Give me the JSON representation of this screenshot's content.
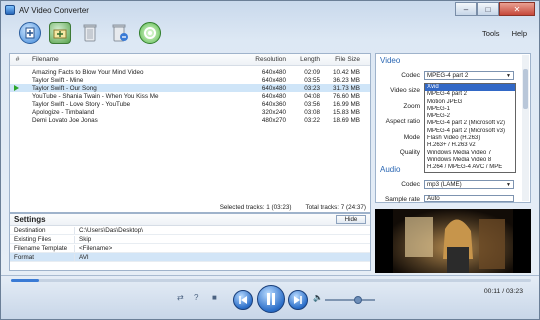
{
  "window": {
    "title": "AV Video Converter"
  },
  "toolbar": {
    "menu": [
      "Tools",
      "Help"
    ]
  },
  "table": {
    "columns": [
      "#",
      "Filename",
      "Resolution",
      "Length",
      "File Size"
    ],
    "rows": [
      {
        "name": "Amazing Facts to Blow Your Mind Video",
        "res": "640x480",
        "len": "02:09",
        "size": "10.42 MB"
      },
      {
        "name": "Taylor Swift - Mine",
        "res": "640x480",
        "len": "03:55",
        "size": "36.23 MB"
      },
      {
        "name": "Taylor Swift - Our Song",
        "res": "640x480",
        "len": "03:23",
        "size": "31.73 MB"
      },
      {
        "name": "YouTube - Shania Twain - When You Kiss Me",
        "res": "640x480",
        "len": "04:08",
        "size": "76.60 MB"
      },
      {
        "name": "Taylor Swift - Love Story - YouTube",
        "res": "640x360",
        "len": "03:56",
        "size": "16.99 MB"
      },
      {
        "name": "Apologize - Timbaland",
        "res": "320x240",
        "len": "03:08",
        "size": "15.83 MB"
      },
      {
        "name": "Demi Lovato Joe Jonas",
        "res": "480x270",
        "len": "03:22",
        "size": "18.69 MB"
      }
    ],
    "selected_tracks": "Selected tracks: 1 (03:23)",
    "total_tracks": "Total tracks: 7 (24:37)"
  },
  "settings": {
    "title": "Settings",
    "hide_label": "Hide",
    "rows": [
      {
        "label": "Destination",
        "value": "C:\\Users\\Das\\Desktop\\"
      },
      {
        "label": "Existing Files",
        "value": "Skip"
      },
      {
        "label": "Filename Template",
        "value": "<Filename>"
      },
      {
        "label": "Format",
        "value": "AVI"
      }
    ]
  },
  "video_panel": {
    "section_video": "Video",
    "section_audio": "Audio",
    "labels": {
      "codec": "Codec",
      "video_size": "Video size",
      "zoom": "Zoom",
      "aspect": "Aspect ratio",
      "mode": "Mode",
      "quality": "Quality",
      "audio_codec": "Codec",
      "sample_rate": "Sample rate"
    },
    "codec_value": "MPEG-4 part 2",
    "audio_codec_value": "mp3 (LAME)",
    "sample_rate_value": "Auto",
    "dropdown": [
      "Xvid",
      "MPEG-4 part 2",
      "Motion JPEG",
      "MPEG-1",
      "MPEG-2",
      "MPEG-4 part 2 (Microsoft v2)",
      "MPEG-4 part 2 (Microsoft v3)",
      "Flash Video (H.263)",
      "H.263+ / H.263 v2",
      "Windows Media Video 7",
      "Windows Media Video 8",
      "H.264 / MPEG-4 AVC / MPE"
    ]
  },
  "player": {
    "time": "00:11 / 03:23",
    "progress_fraction": 0.054,
    "volume_fraction": 0.65
  },
  "colors": {
    "accent": "#3268c6",
    "selection": "#cfe5f8"
  }
}
